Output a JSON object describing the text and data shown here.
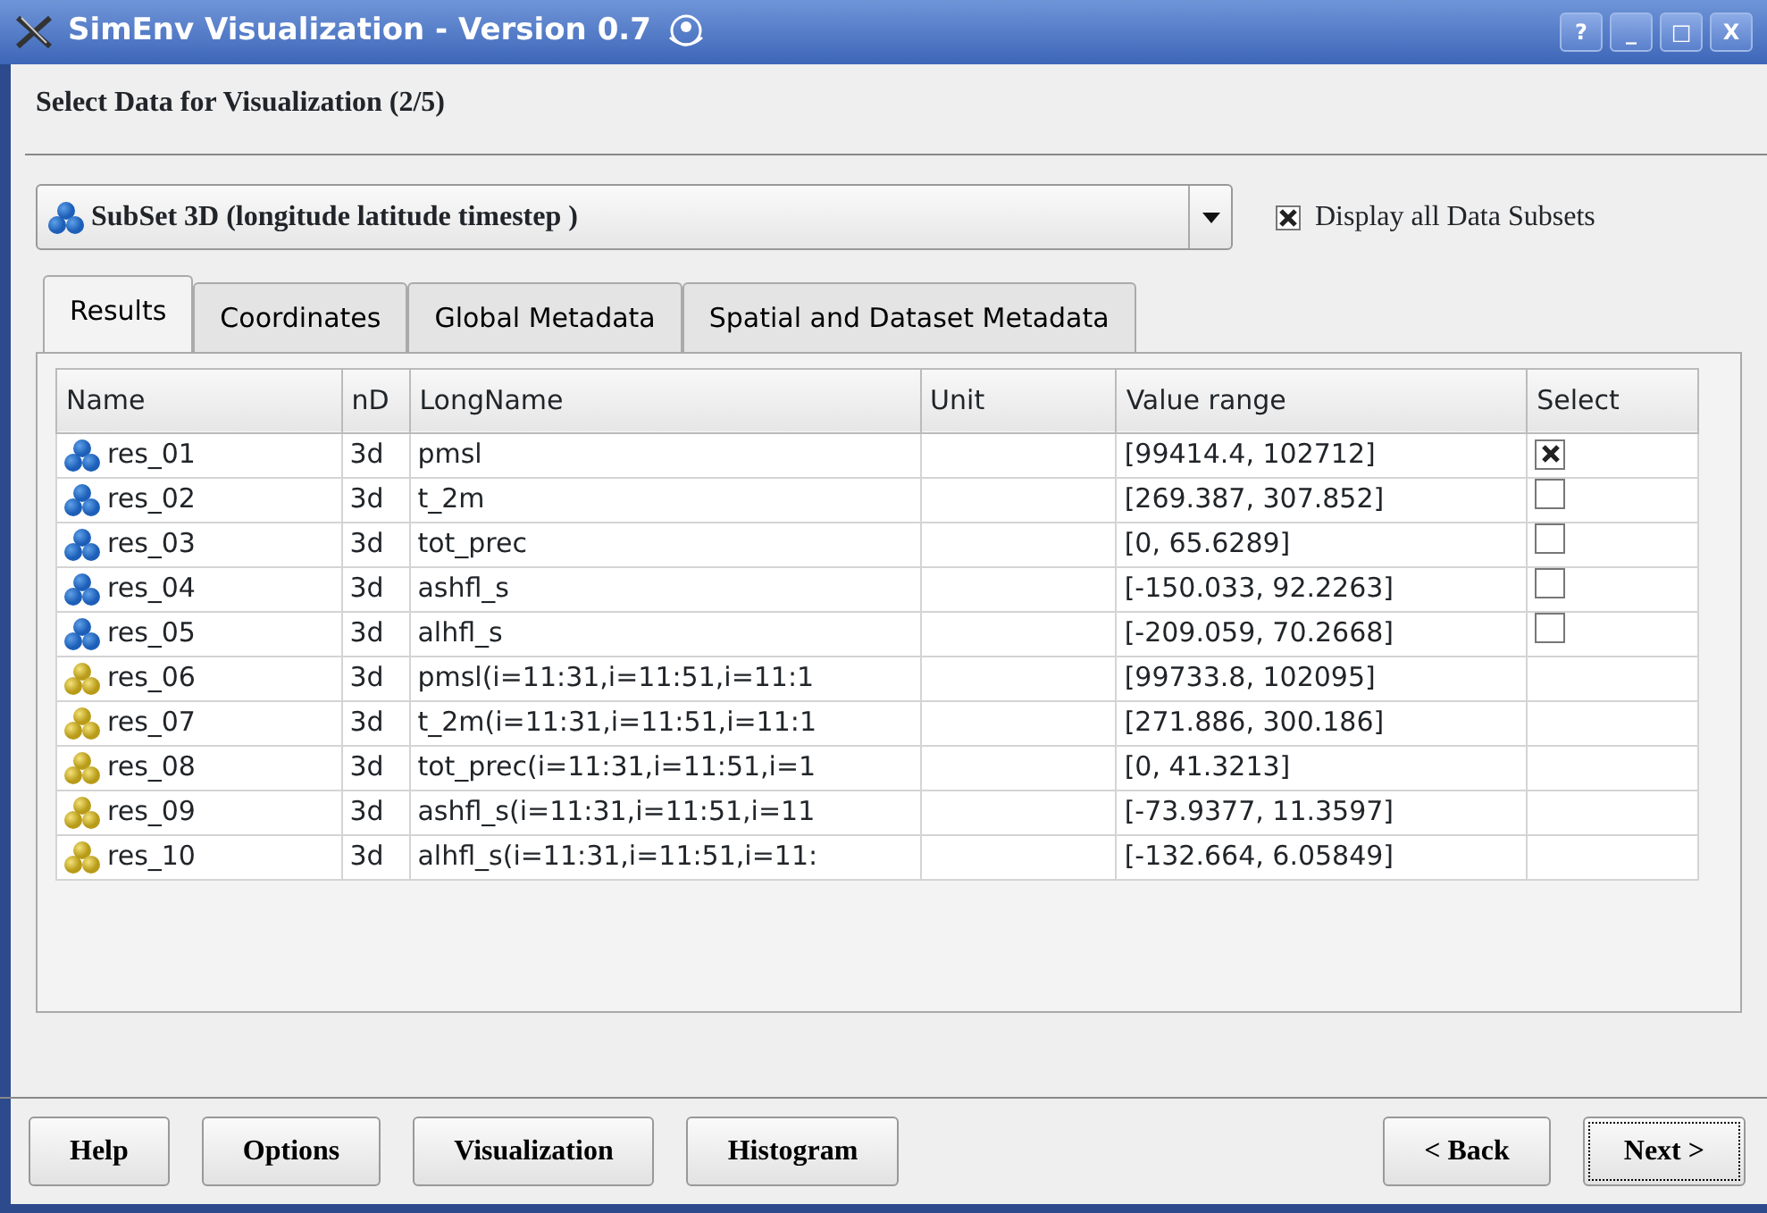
{
  "window": {
    "title": "SimEnv Visualization - Version 0.7",
    "controls": [
      "?",
      "_",
      "□",
      "X"
    ]
  },
  "step_title": "Select Data for Visualization (2/5)",
  "subset_select": {
    "value": "SubSet 3D (longitude latitude timestep )"
  },
  "display_all": {
    "label": "Display all Data Subsets",
    "checked": true
  },
  "tabs": [
    {
      "label": "Results",
      "selected": true
    },
    {
      "label": "Coordinates",
      "selected": false
    },
    {
      "label": "Global Metadata",
      "selected": false
    },
    {
      "label": "Spatial and Dataset Metadata",
      "selected": false
    }
  ],
  "table": {
    "columns": [
      "Name",
      "nD",
      "LongName",
      "Unit",
      "Value range",
      "Select"
    ],
    "rows": [
      {
        "kind": "plain",
        "name": "res_01",
        "nd": "3d",
        "long_name": "pmsl",
        "value_range": "[99414.4, 102712]",
        "checked": true
      },
      {
        "kind": "plain",
        "name": "res_02",
        "nd": "3d",
        "long_name": "t_2m",
        "value_range": "[269.387, 307.852]",
        "checked": false
      },
      {
        "kind": "plain",
        "name": "res_03",
        "nd": "3d",
        "long_name": "tot_prec",
        "value_range": "[0, 65.6289]",
        "checked": false
      },
      {
        "kind": "plain",
        "name": "res_04",
        "nd": "3d",
        "long_name": "ashfl_s",
        "value_range": "[-150.033, 92.2263]",
        "checked": false
      },
      {
        "kind": "plain",
        "name": "res_05",
        "nd": "3d",
        "long_name": "alhfl_s",
        "value_range": "[-209.059, 70.2668]",
        "checked": false
      },
      {
        "kind": "derived",
        "name": "res_06",
        "nd": "3d",
        "long_name": "pmsl(i=11:31,i=11:51,i=11:1",
        "value_range": "[99733.8, 102095]"
      },
      {
        "kind": "derived",
        "name": "res_07",
        "nd": "3d",
        "long_name": "t_2m(i=11:31,i=11:51,i=11:1",
        "value_range": "[271.886, 300.186]"
      },
      {
        "kind": "derived",
        "name": "res_08",
        "nd": "3d",
        "long_name": "tot_prec(i=11:31,i=11:51,i=1",
        "value_range": "[0, 41.3213]"
      },
      {
        "kind": "derived",
        "name": "res_09",
        "nd": "3d",
        "long_name": "ashfl_s(i=11:31,i=11:51,i=11",
        "value_range": "[-73.9377, 11.3597]"
      },
      {
        "kind": "derived",
        "name": "res_10",
        "nd": "3d",
        "long_name": "alhfl_s(i=11:31,i=11:51,i=11:",
        "value_range": "[-132.664, 6.05849]"
      }
    ]
  },
  "buttons_left": [
    "Help",
    "Options",
    "Visualization",
    "Histogram"
  ],
  "buttons_right": [
    {
      "label": "< Back",
      "focused": false
    },
    {
      "label": "Next >",
      "focused": true
    }
  ]
}
